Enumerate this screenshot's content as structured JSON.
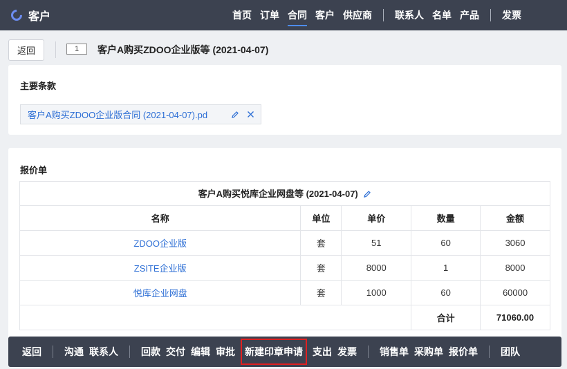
{
  "header": {
    "app_name": "客户",
    "nav": [
      "首页",
      "订单",
      "合同",
      "客户",
      "供应商",
      "联系人",
      "名单",
      "产品",
      "发票"
    ],
    "active_nav": "合同"
  },
  "toolbar": {
    "back_label": "返回",
    "record_id": "1",
    "title": "客户A购买ZDOO企业版等 (2021-04-07)"
  },
  "terms": {
    "title": "主要条款",
    "file_name": "客户A购买ZDOO企业版合同 (2021-04-07).pd",
    "edit_icon": "pencil-icon",
    "delete_icon": "close-icon"
  },
  "quote": {
    "title": "报价单",
    "caption": "客户A购买悦库企业网盘等 (2021-04-07)",
    "columns": [
      "名称",
      "单位",
      "单价",
      "数量",
      "金额"
    ],
    "rows": [
      [
        "ZDOO企业版",
        "套",
        "51",
        "60",
        "3060"
      ],
      [
        "ZSITE企业版",
        "套",
        "8000",
        "1",
        "8000"
      ],
      [
        "悦库企业网盘",
        "套",
        "1000",
        "60",
        "60000"
      ]
    ],
    "total_label": "合计",
    "total_value": "71060.00"
  },
  "actions": {
    "back": "返回",
    "communicate": "沟通",
    "contact": "联系人",
    "payment_back": "回款",
    "deliver": "交付",
    "edit": "编辑",
    "approve": "审批",
    "new_seal": "新建印章申请",
    "expense": "支出",
    "invoice": "发票",
    "sales_order": "销售单",
    "purchase_order": "采购单",
    "quote_order": "报价单",
    "team": "团队"
  },
  "colors": {
    "navbar": "#3c4250",
    "link": "#2c6ed5",
    "highlight_border": "#e02020"
  }
}
